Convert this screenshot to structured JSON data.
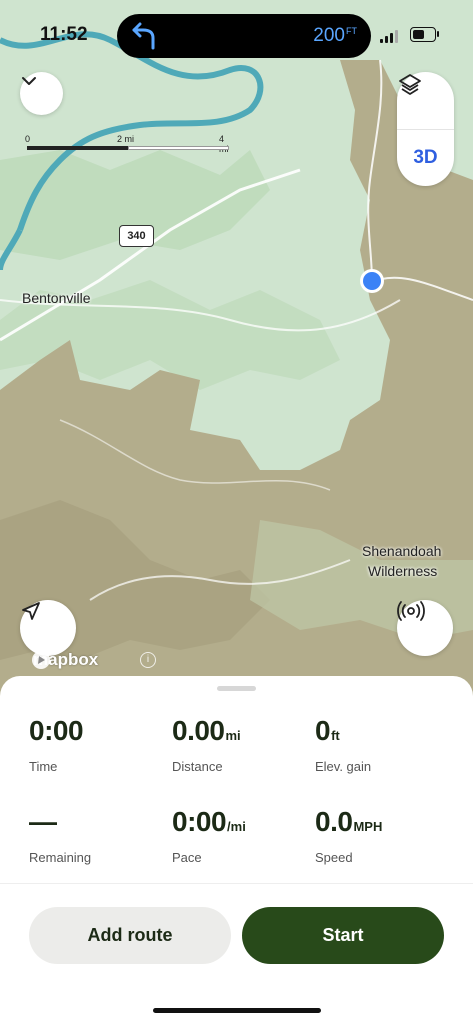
{
  "status_bar": {
    "time": "11:52"
  },
  "navigation_banner": {
    "distance_value": "200",
    "distance_unit": "FT",
    "turn_icon": "turn-left-arrow-icon"
  },
  "map": {
    "scale": {
      "tick_0": "0",
      "tick_1": "2 mi",
      "tick_2": "4 mi"
    },
    "labels": {
      "bentonville": "Bentonville",
      "shenandoah_line1": "Shenandoah",
      "shenandoah_line2": "Wilderness",
      "route_shield": "340"
    },
    "layers_button_icon": "layers-icon",
    "three_d_label": "3D",
    "attribution": "mapbox",
    "colors": {
      "lowland": "#cfe4cf",
      "forest": "#bcd9b8",
      "mountain": "#b3ad8c",
      "river": "#4fa9b8",
      "location": "#3b82f6"
    }
  },
  "stats": {
    "time": {
      "value": "0:00",
      "label": "Time"
    },
    "distance": {
      "value": "0.00",
      "unit": "mi",
      "label": "Distance"
    },
    "elevation": {
      "value": "0",
      "unit": "ft",
      "label": "Elev. gain"
    },
    "remaining": {
      "value": "—",
      "label": "Remaining"
    },
    "pace": {
      "value": "0:00",
      "unit": "/mi",
      "label": "Pace"
    },
    "speed": {
      "value": "0.0",
      "unit": "MPH",
      "label": "Speed"
    }
  },
  "actions": {
    "add_route": "Add route",
    "start": "Start"
  }
}
